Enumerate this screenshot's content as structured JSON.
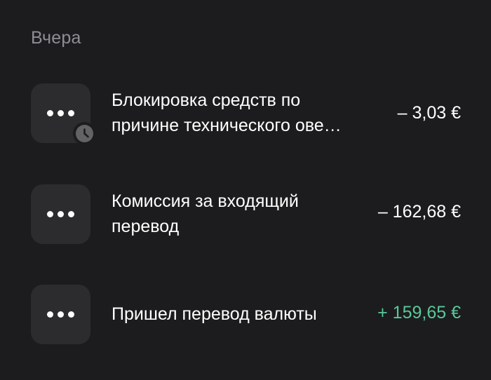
{
  "section": {
    "title": "Вчера"
  },
  "transactions": [
    {
      "line1": "Блокировка средств по",
      "line2": "причине технического ове…",
      "amount": "– 3,03 €",
      "icon": "more-dots-icon",
      "status_icon": "clock-icon"
    },
    {
      "line1": "Комиссия за входящий",
      "line2": "перевод",
      "amount": "– 162,68 €",
      "icon": "more-dots-icon"
    },
    {
      "line1": "Пришел перевод валюты",
      "amount": "+ 159,65 €",
      "icon": "more-dots-icon",
      "amount_color": "#5ac89a"
    }
  ],
  "colors": {
    "background": "#1c1c1e",
    "tile": "#2c2c2e",
    "muted_text": "#8e8e93",
    "positive": "#5ac89a"
  }
}
